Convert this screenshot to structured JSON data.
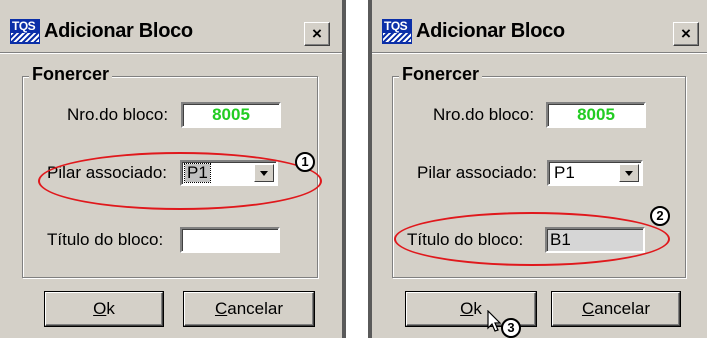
{
  "dialogs": [
    {
      "logo_text": "TQS",
      "title": "Adicionar Bloco",
      "close_glyph": "×",
      "group_title": "Fonercer",
      "nro_label": "Nro.do bloco:",
      "nro_value": "8005",
      "pilar_label": "Pilar associado:",
      "pilar_value": "P1",
      "titulo_label": "Título do bloco:",
      "titulo_value": "",
      "ok_mnemonic": "O",
      "ok_rest": "k",
      "cancel_mnemonic": "C",
      "cancel_rest": "ancelar",
      "marker": "1"
    },
    {
      "logo_text": "TQS",
      "title": "Adicionar Bloco",
      "close_glyph": "×",
      "group_title": "Fonercer",
      "nro_label": "Nro.do bloco:",
      "nro_value": "8005",
      "pilar_label": "Pilar associado:",
      "pilar_value": "P1",
      "titulo_label": "Título do bloco:",
      "titulo_value": "B1",
      "ok_mnemonic": "O",
      "ok_rest": "k",
      "cancel_mnemonic": "C",
      "cancel_rest": "ancelar",
      "marker_titulo": "2",
      "marker_ok": "3"
    }
  ],
  "colors": {
    "highlight_ellipse": "#e0181c",
    "number_text": "#22cc22",
    "window_face": "#d4d0c8",
    "logo_bg": "#0b2fa8"
  },
  "icons": [
    "tqs-logo-icon",
    "close-icon",
    "dropdown-arrow-icon",
    "mouse-pointer-icon"
  ]
}
